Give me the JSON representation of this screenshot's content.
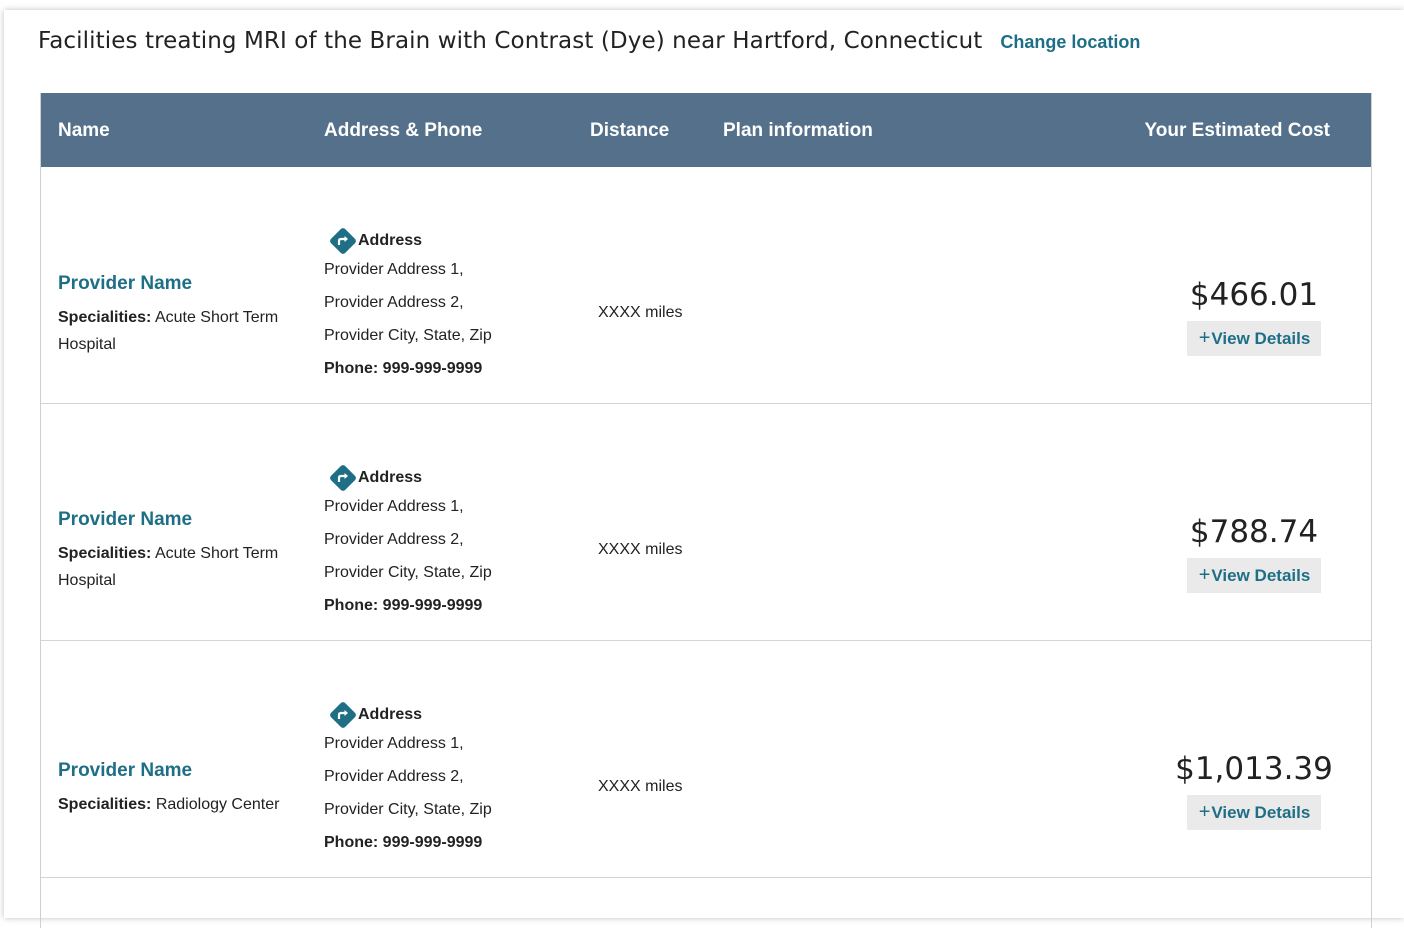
{
  "header": {
    "title": "Facilities treating MRI of the Brain with Contrast (Dye) near Hartford, Connecticut",
    "change_location": "Change location"
  },
  "table": {
    "columns": {
      "name": "Name",
      "address": "Address & Phone",
      "distance": "Distance",
      "plan": "Plan information",
      "cost": "Your Estimated Cost"
    },
    "rows": [
      {
        "provider_name": "Provider Name",
        "specialities_label": "Specialities:",
        "specialities": "Acute Short Term Hospital",
        "address_label": "Address",
        "address1": "Provider Address 1,",
        "address2": "Provider Address 2,",
        "city": "Provider City, State, Zip",
        "phone": "Phone: 999-999-9999",
        "distance": "XXXX miles",
        "price": "$466.01",
        "details_plus": "+",
        "details_label": "View Details"
      },
      {
        "provider_name": "Provider Name",
        "specialities_label": "Specialities:",
        "specialities": "Acute Short Term Hospital",
        "address_label": "Address",
        "address1": "Provider Address 1,",
        "address2": "Provider Address 2,",
        "city": "Provider City, State, Zip",
        "phone": "Phone: 999-999-9999",
        "distance": "XXXX miles",
        "price": "$788.74",
        "details_plus": "+",
        "details_label": "View Details"
      },
      {
        "provider_name": "Provider Name",
        "specialities_label": "Specialities:",
        "specialities": "Radiology Center",
        "address_label": "Address",
        "address1": "Provider Address 1,",
        "address2": "Provider Address 2,",
        "city": "Provider City, State, Zip",
        "phone": "Phone: 999-999-9999",
        "distance": "XXXX miles",
        "price": "$1,013.39",
        "details_plus": "+",
        "details_label": "View Details"
      }
    ]
  },
  "icons": {
    "directions": "directions-icon"
  },
  "colors": {
    "header_bg": "#54708a",
    "link": "#1e6f86",
    "button_bg": "#eaeaea"
  }
}
